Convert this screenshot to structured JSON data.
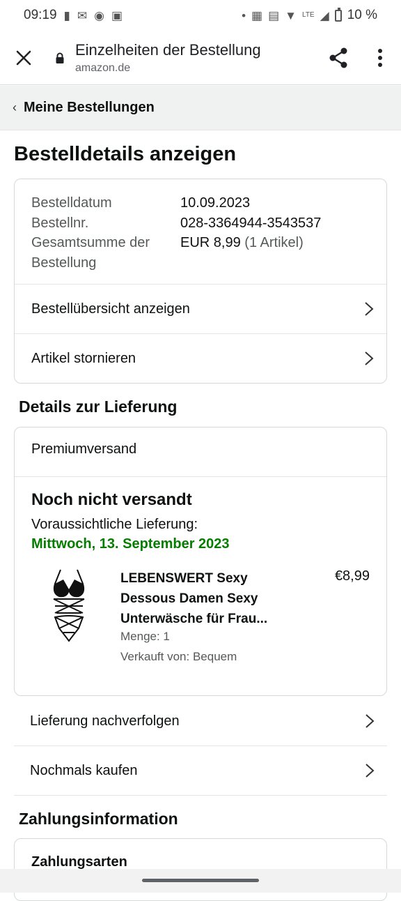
{
  "status_bar": {
    "time": "09:19",
    "battery": "10 %",
    "network": "LTE"
  },
  "app_bar": {
    "title": "Einzelheiten der Bestellung",
    "url": "amazon.de"
  },
  "breadcrumb": {
    "label": "Meine Bestellungen"
  },
  "page_title": "Bestelldetails anzeigen",
  "order_summary": {
    "rows": [
      {
        "key": "Bestelldatum",
        "value": "10.09.2023"
      },
      {
        "key": "Bestellnr.",
        "value": "028-3364944-3543537"
      }
    ],
    "total_key": "Gesamtsumme der Bestellung",
    "total_value": "EUR 8,99",
    "total_items": "(1 Artikel)",
    "links": [
      "Bestellübersicht anzeigen",
      "Artikel stornieren"
    ]
  },
  "delivery": {
    "section_title": "Details zur Lieferung",
    "shipping_type": "Premiumversand",
    "status": "Noch nicht versandt",
    "eta_label": "Voraussichtliche Lieferung:",
    "eta_date": "Mittwoch, 13. September 2023",
    "product": {
      "name": "LEBENSWERT Sexy Dessous Damen Sexy Unterwäsche für Frau...",
      "price": "€8,99",
      "quantity": "Menge: 1",
      "seller": "Verkauft von: Bequem"
    },
    "actions": [
      "Lieferung nachverfolgen",
      "Nochmals kaufen"
    ],
    "colors": {
      "eta": "#067d00"
    }
  },
  "payment": {
    "section_title": "Zahlungsinformation",
    "methods_title": "Zahlungsarten"
  }
}
